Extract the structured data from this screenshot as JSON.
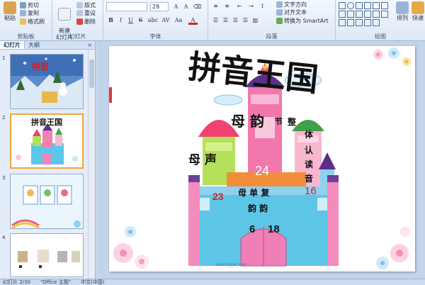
{
  "ribbon": {
    "clipboard": {
      "paste": "粘贴",
      "cut": "剪切",
      "copy": "复制",
      "format_painter": "格式刷",
      "group_label": "剪贴板"
    },
    "slides": {
      "new_slide": "新建\n幻灯片",
      "layout": "版式",
      "reset": "重设",
      "delete": "删除",
      "group_label": "幻灯片"
    },
    "font": {
      "size": "28",
      "group_label": "字体",
      "bold": "B",
      "italic": "I",
      "underline": "U",
      "strike": "S",
      "shadow": "abc",
      "spacing": "AV",
      "case": "Aa",
      "color": "A"
    },
    "paragraph": {
      "text_direction": "文字方向",
      "align_text": "对齐文本",
      "smartart": "转换为 SmartArt",
      "group_label": "段落"
    },
    "drawing": {
      "arrange": "排列",
      "quick_styles": "快速",
      "group_label": "绘图"
    }
  },
  "panel": {
    "tab_slides": "幻灯片",
    "tab_outline": "大纲",
    "close": "×",
    "thumbs": [
      {
        "num": "1",
        "title": "拼音"
      },
      {
        "num": "2",
        "title": "拼音王国"
      },
      {
        "num": "3",
        "title": ""
      },
      {
        "num": "4",
        "title": ""
      }
    ]
  },
  "slide": {
    "title": "拼音王国",
    "label_yunmu": "母 韵",
    "label_zhengti_1": "整",
    "label_zhengti_2": "体",
    "label_zhengti_3": "认",
    "label_zhengti_4": "读",
    "label_zhengti_5": "音",
    "label_zhengti_6": "节",
    "label_shengmu": "母 声",
    "label_fu": "母 单 复",
    "label_yun": "韵 韵",
    "n24": "24",
    "n23": "23",
    "n16": "16",
    "n6": "6",
    "n18": "18",
    "watermark": "www.hcjlpic.com"
  },
  "status": {
    "slide_info": "幻灯片 2/30",
    "theme": "\"Office 主题\"",
    "lang": "中文(中国)"
  }
}
